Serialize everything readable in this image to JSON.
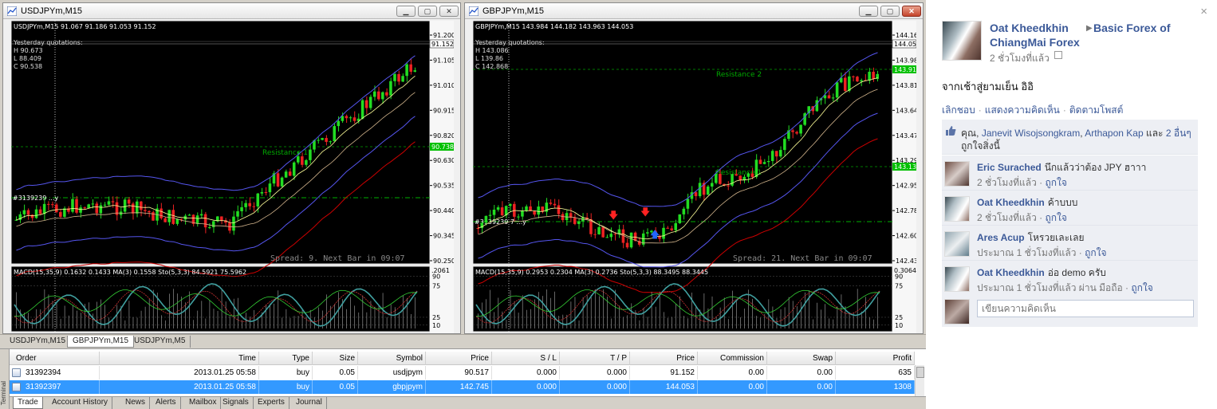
{
  "charts": [
    {
      "window_title": "USDJPYm,M15",
      "info_line": "USDJPYm,M15  91.067 91.186 91.053 91.152",
      "yesterday_label": "Yesterday quotations:",
      "yesterday_h": "H 90.673",
      "yesterday_l": "L 88.409",
      "yesterday_c": "C 90.538",
      "order_label": "#3139239",
      "order_suffix": "...y",
      "resistance_label": "Resistance 1",
      "spread_text": "Spread: 9.  Next Bar in 09:07",
      "price_labels": [
        "91.200",
        "91.105",
        "91.010",
        "90.915",
        "90.820",
        "90.630",
        "90.535",
        "90.440",
        "90.345",
        "90.250"
      ],
      "current_price": "91.152",
      "green_tag": "90.738",
      "macd_text": "MACD(15,35,9) 0.1632 0.1433  MA(3) 0.1558  Sto(5,3,3) 84.5921 75.5962",
      "sub_labels": [
        "90",
        "75",
        "25",
        "10"
      ],
      "sub_top": ".2061",
      "color_up": "#22dd22",
      "color_down": "#ee2222"
    },
    {
      "window_title": "GBPJPYm,M15",
      "info_line": "GBPJPYm,M15  143.984 144.182 143.963 144.053",
      "yesterday_label": "Yesterday quotations:",
      "yesterday_h": "H 143.086",
      "yesterday_l": "L 139.86",
      "yesterday_c": "C 142.868",
      "order_label": "#3139239",
      "order_suffix": "7 ...y",
      "resistance_label": "Resistance 1",
      "resistance2_label": "Resistance 2",
      "spread_text": "Spread: 21.  Next Bar in 09:07",
      "price_labels": [
        "144.160",
        "143.985",
        "143.815",
        "143.640",
        "143.470",
        "143.295",
        "142.950",
        "142.780",
        "142.605",
        "142.435"
      ],
      "current_price": "144.053",
      "green_tag": "143.130",
      "green_tag2": "143.91",
      "macd_text": "MACD(15,35,9) 0.2953 0.2304  MA(3) 0.2736  Sto(5,3,3) 88.3495 88.3445",
      "sub_labels": [
        "90",
        "75",
        "25",
        "10"
      ],
      "sub_top": "0.3064",
      "color_up": "#22dd22",
      "color_down": "#ee2222"
    }
  ],
  "chart_tabs": [
    "USDJPYm,M15",
    "GBPJPYm,M15",
    "USDJPYm,M5"
  ],
  "orders": {
    "columns": [
      "Order",
      "Time",
      "Type",
      "Size",
      "Symbol",
      "Price",
      "S / L",
      "T / P",
      "Price",
      "Commission",
      "Swap",
      "Profit"
    ],
    "rows": [
      [
        "31392394",
        "2013.01.25 05:58",
        "buy",
        "0.05",
        "usdjpym",
        "90.517",
        "0.000",
        "0.000",
        "91.152",
        "0.00",
        "0.00",
        "635"
      ],
      [
        "31392397",
        "2013.01.25 05:58",
        "buy",
        "0.05",
        "gbpjpym",
        "142.745",
        "0.000",
        "0.000",
        "144.053",
        "0.00",
        "0.00",
        "1308"
      ]
    ]
  },
  "terminal_label": "Terminal",
  "bottom_tabs": [
    "Trade",
    "Account History",
    "News",
    "Alerts",
    "Mailbox",
    "Signals",
    "Experts",
    "Journal"
  ],
  "facebook": {
    "close": "×",
    "author": "Oat Kheedkhin",
    "page_line1": "Basic Forex of",
    "page_line2": "ChiangMai Forex",
    "time": "2 ชั่วโมงที่แล้ว",
    "post_text": "จากเช้าสู่ยามเย็น อิอิ",
    "actions": [
      "เลิกชอบ",
      "แสดงความคิดเห็น",
      "ติดตามโพสต์"
    ],
    "likes": {
      "prefix": "คุณ,",
      "names": [
        "Janevit Wisojsongkram",
        "Arthapon Kap"
      ],
      "joiner": "และ",
      "others": "2 อื่นๆ",
      "suffix": "ถูกใจสิ่งนี้"
    },
    "comments": [
      {
        "name": "Eric Surached",
        "text": "นึกแล้วว่าต้อง JPY ฮาาา",
        "time": "2 ชั่วโมงที่แล้ว",
        "like": "ถูกใจ"
      },
      {
        "name": "Oat Kheedkhin",
        "text": "ค้าบบบ",
        "time": "2 ชั่วโมงที่แล้ว",
        "like": "ถูกใจ"
      },
      {
        "name": "Ares Acup",
        "text": "โหรวยเละเลย",
        "time": "ประมาณ 1 ชั่วโมงที่แล้ว",
        "like": "ถูกใจ"
      },
      {
        "name": "Oat Kheedkhin",
        "text": "อ่อ demo ครับ",
        "time": "ประมาณ 1 ชั่วโมงที่แล้ว ผ่าน มือถือ",
        "like": "ถูกใจ"
      }
    ],
    "write_placeholder": "เขียนความคิดเห็น"
  }
}
